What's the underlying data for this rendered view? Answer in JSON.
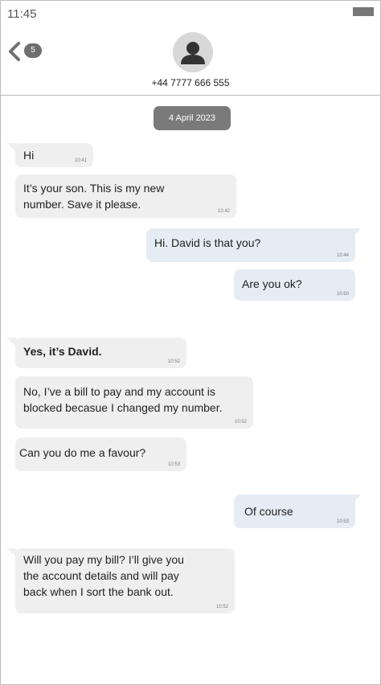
{
  "status": {
    "time": "11:45"
  },
  "header": {
    "unread_count": "5",
    "phone_number": "+44 7777 666 555"
  },
  "date_chip": "4 April 2023",
  "messages": [
    {
      "direction": "incoming",
      "text": "Hi",
      "time": "10:41"
    },
    {
      "direction": "incoming",
      "text": "It’s your son. This is my new\nnumber. Save it please.",
      "time": "10:42"
    },
    {
      "direction": "outgoing",
      "text": "Hi. David is that you?",
      "time": "10:44"
    },
    {
      "direction": "outgoing",
      "text": "Are you ok?",
      "time": "10:50"
    },
    {
      "direction": "incoming",
      "text": "Yes, it’s David.",
      "time": "10:52"
    },
    {
      "direction": "incoming",
      "text": "No, I’ve a bill to pay and my account is\nblocked becasue I changed my number.",
      "time": "10:52"
    },
    {
      "direction": "incoming",
      "text": "Can you do me a favour?",
      "time": "10:53"
    },
    {
      "direction": "outgoing",
      "text": "Of course",
      "time": "10:53"
    },
    {
      "direction": "incoming",
      "text": "Will you pay my bill? I’ll give you\nthe account details and will pay\nback when I sort the bank out.",
      "time": "10:52"
    }
  ],
  "icons": {
    "back": "chevron-left-icon",
    "avatar": "person-icon"
  },
  "colors": {
    "incoming_bubble": "#efefef",
    "outgoing_bubble": "#e5ecf3",
    "chip": "#7a7a7a"
  }
}
